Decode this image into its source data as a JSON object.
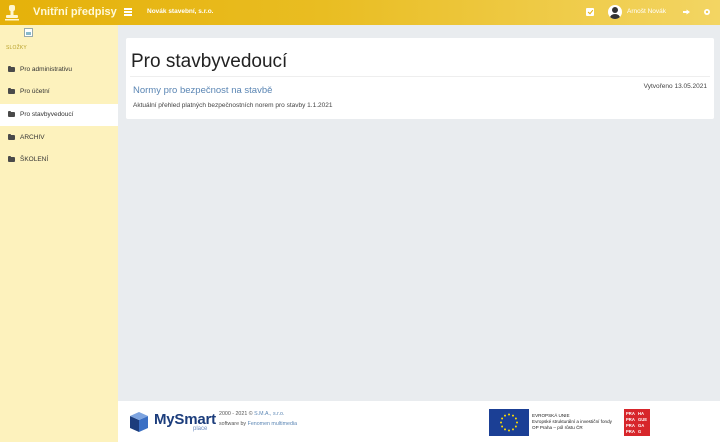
{
  "app": {
    "title": "Vnitřní předpisy",
    "company": "Novák stavební, s.r.o.",
    "user": "Arnošt Novák"
  },
  "sidebar": {
    "heading": "SLOŽKY",
    "items": [
      {
        "label": "Pro administrativu",
        "active": false
      },
      {
        "label": "Pro účetní",
        "active": false
      },
      {
        "label": "Pro stavbyvedoucí",
        "active": true
      },
      {
        "label": "ARCHIV",
        "active": false
      },
      {
        "label": "ŠKOLENÍ",
        "active": false
      }
    ]
  },
  "main": {
    "page_title": "Pro stavbyvedoucí",
    "document": {
      "title": "Normy pro bezpečnost na stavbě",
      "created": "Vytvořeno 13.05.2021",
      "description": "Aktuální přehled platných bezpečnostních norem pro stavby 1.1.2021"
    }
  },
  "footer": {
    "brand_name": "MySmart",
    "brand_sub": "place",
    "copyright_prefix": "2000 - 2021 ©",
    "copyright_company": "S.M.A., s.r.o.",
    "software_prefix": "software by",
    "software_company": "Fenomen multimedia",
    "eu_line1": "EVROPSKÁ UNIE",
    "eu_line2": "Evropské strukturální a investiční fondy",
    "eu_line3": "OP Praha – pól růstu ČR",
    "praha_logo": "PRAHA PRAGUE PRAGA PRAG"
  },
  "colors": {
    "accent": "#e9bd22",
    "sidebar_bg": "#fdf2bd",
    "link": "#5b86b4",
    "background": "#e9ecef"
  },
  "icons": [
    "brand-stamp-icon",
    "menu-icon",
    "check-icon",
    "user-avatar-icon",
    "logout-icon",
    "settings-icon",
    "folder-icon",
    "broken-image-icon",
    "mysmart-logo-icon",
    "eu-flag-icon",
    "praha-logo-icon"
  ]
}
